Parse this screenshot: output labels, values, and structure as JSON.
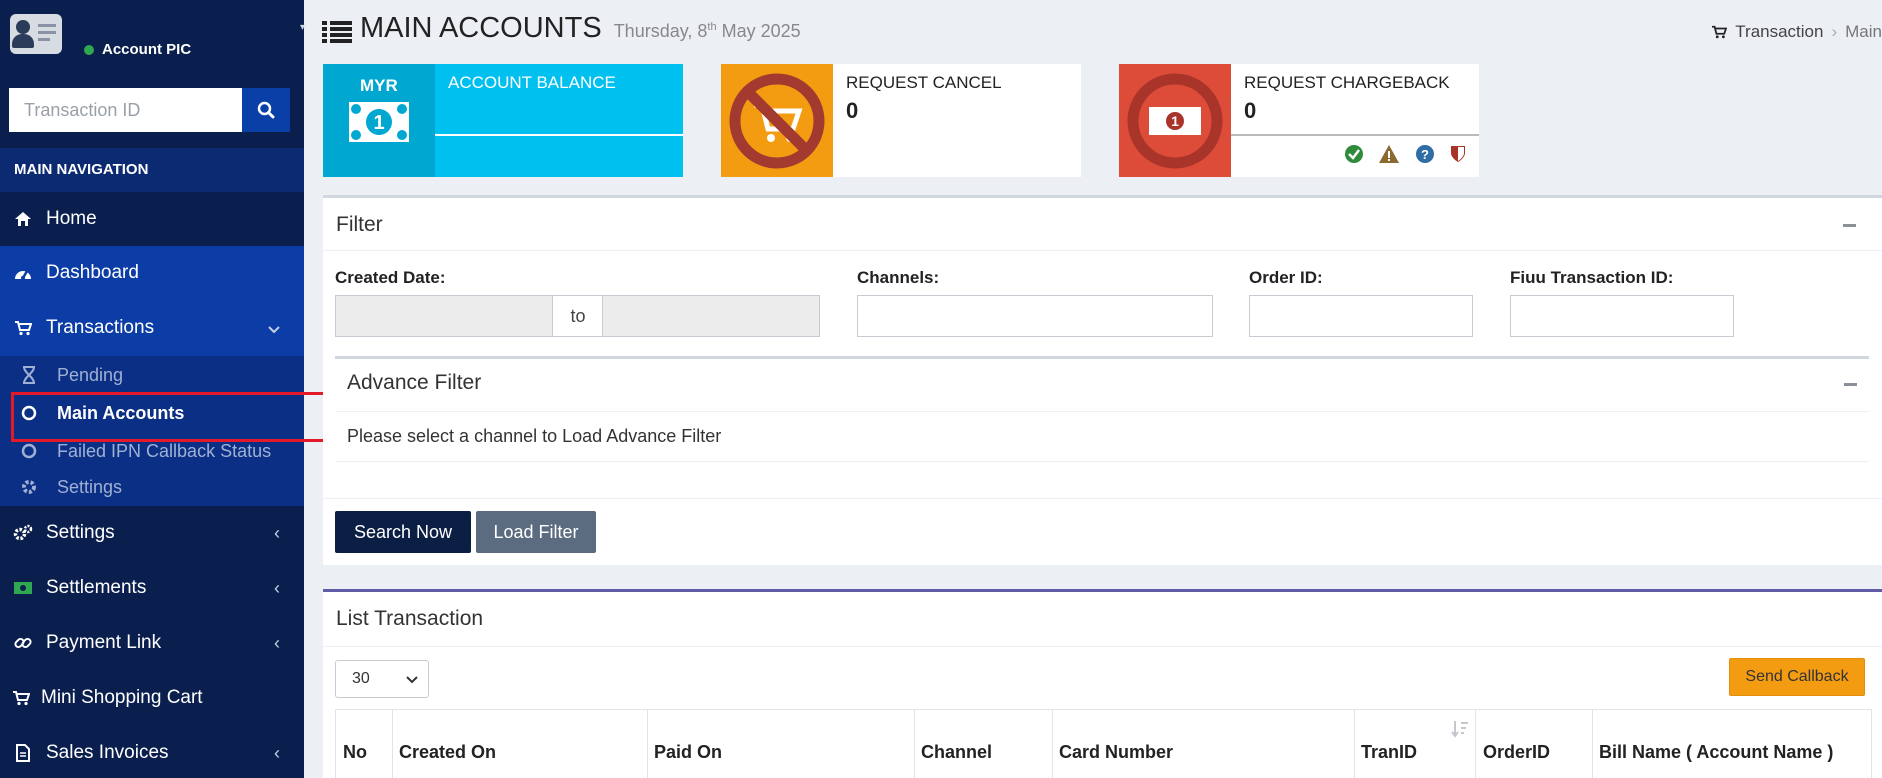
{
  "sidebar": {
    "user_name": "Account PIC",
    "search_placeholder": "Transaction ID",
    "nav_header": "MAIN NAVIGATION",
    "items": [
      {
        "label": "Home",
        "icon": "home-icon"
      },
      {
        "label": "Dashboard",
        "icon": "dashboard-icon"
      },
      {
        "label": "Transactions",
        "icon": "cart-icon"
      },
      {
        "label": "Settings",
        "icon": "gears-icon"
      },
      {
        "label": "Settlements",
        "icon": "money-icon"
      },
      {
        "label": "Payment Link",
        "icon": "link-icon"
      },
      {
        "label": "Mini Shopping Cart",
        "icon": "cart-icon"
      },
      {
        "label": "Sales Invoices",
        "icon": "document-icon"
      }
    ],
    "sub_items": [
      {
        "label": "Pending",
        "icon": "hourglass-icon"
      },
      {
        "label": "Main Accounts",
        "icon": "circle-icon"
      },
      {
        "label": "Failed IPN Callback Status",
        "icon": "circle-icon"
      },
      {
        "label": "Settings",
        "icon": "gear-icon"
      }
    ]
  },
  "header": {
    "title": "MAIN ACCOUNTS",
    "date_prefix": "Thursday, 8",
    "date_sup": "th",
    "date_suffix": " May 2025",
    "breadcrumb": [
      "Transaction",
      "Main"
    ]
  },
  "info_boxes": {
    "balance": {
      "currency": "MYR",
      "label": "ACCOUNT BALANCE",
      "color": "#00c0ef",
      "dark": "#00a7d0"
    },
    "cancel": {
      "label": "REQUEST CANCEL",
      "value": "0",
      "color": "#f39c12"
    },
    "chargeback": {
      "label": "REQUEST CHARGEBACK",
      "value": "0",
      "color": "#dd4b39"
    }
  },
  "filter": {
    "title": "Filter",
    "created_date_label": "Created Date:",
    "to_label": "to",
    "channels_label": "Channels:",
    "order_id_label": "Order ID:",
    "fiuu_label": "Fiuu Transaction ID:",
    "advance_title": "Advance Filter",
    "advance_message": "Please select a channel to Load Advance Filter",
    "search_button": "Search Now",
    "load_button": "Load Filter"
  },
  "list": {
    "title": "List Transaction",
    "page_size": "30",
    "callback_button": "Send Callback",
    "columns": [
      "No",
      "Created On",
      "Paid On",
      "Channel",
      "Card Number",
      "TranID",
      "OrderID",
      "Bill Name ( Account Name )"
    ]
  },
  "colors": {
    "sidebar": "#0a1f4e",
    "active": "#0c3da6",
    "accent_purple": "#605ca8",
    "search_btn": "#0b1f44",
    "load_btn": "#5b6b80",
    "callback_btn": "#f39c12"
  }
}
